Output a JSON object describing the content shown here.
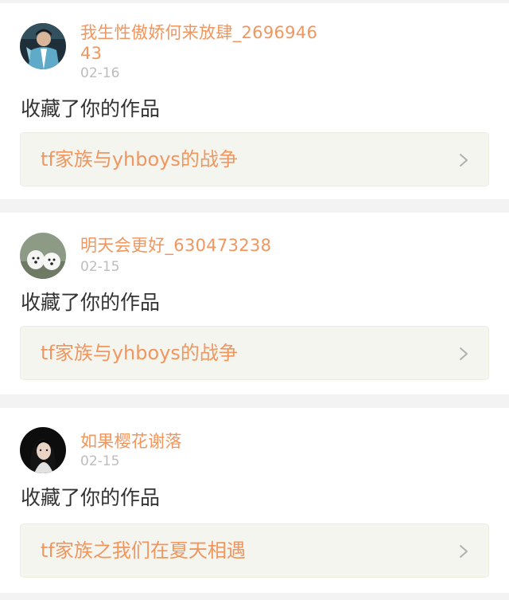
{
  "notifications": [
    {
      "user_name": "我生性傲娇何来放肆_269694643",
      "date": "02-16",
      "action": "收藏了你的作品",
      "work_title": "tf家族与yhboys的战争",
      "avatar_icon": "avatar-person-blue-jacket"
    },
    {
      "user_name": "明天会更好_630473238",
      "date": "02-15",
      "action": "收藏了你的作品",
      "work_title": "tf家族与yhboys的战争",
      "avatar_icon": "avatar-white-puppies"
    },
    {
      "user_name": "如果樱花谢落",
      "date": "02-15",
      "action": "收藏了你的作品",
      "work_title": "tf家族之我们在夏天相遇",
      "avatar_icon": "avatar-person-dark-hair"
    }
  ],
  "colors": {
    "accent": "#f0965e",
    "date": "#bdbdbd",
    "text": "#333333",
    "work_card_bg": "#f5f5ef",
    "page_bg": "#f3f3f3"
  }
}
